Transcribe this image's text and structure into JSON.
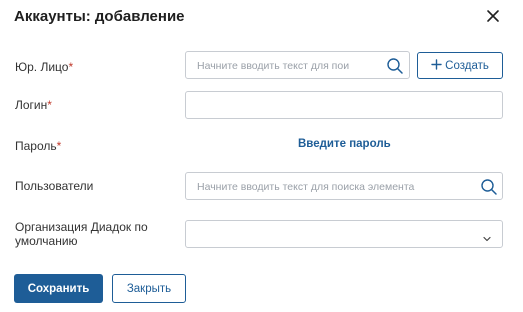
{
  "dialog": {
    "title": "Аккаунты: добавление",
    "close_icon": "close-icon"
  },
  "fields": {
    "legal_entity": {
      "label": "Юр. Лицо",
      "required_mark": "*",
      "placeholder": "Начните вводить текст для пои",
      "create_button": "Создать",
      "create_icon": "plus-icon",
      "search_icon": "search-icon"
    },
    "login": {
      "label": "Логин",
      "required_mark": "*",
      "value": ""
    },
    "password": {
      "label": "Пароль",
      "required_mark": "*",
      "link": "Введите пароль"
    },
    "users": {
      "label": "Пользователи",
      "placeholder": "Начните вводить текст для поиска элемента",
      "search_icon": "search-icon"
    },
    "diadoc_org": {
      "label_line1": "Организация Диадок по",
      "label_line2": "умолчанию",
      "value": "",
      "dropdown_icon": "chevron-down-icon"
    }
  },
  "footer": {
    "save_label": "Сохранить",
    "close_label": "Закрыть"
  },
  "colors": {
    "accent": "#1e5d97",
    "required": "#c0392b",
    "border": "#c8ccd2",
    "placeholder": "#9aa0a8"
  }
}
